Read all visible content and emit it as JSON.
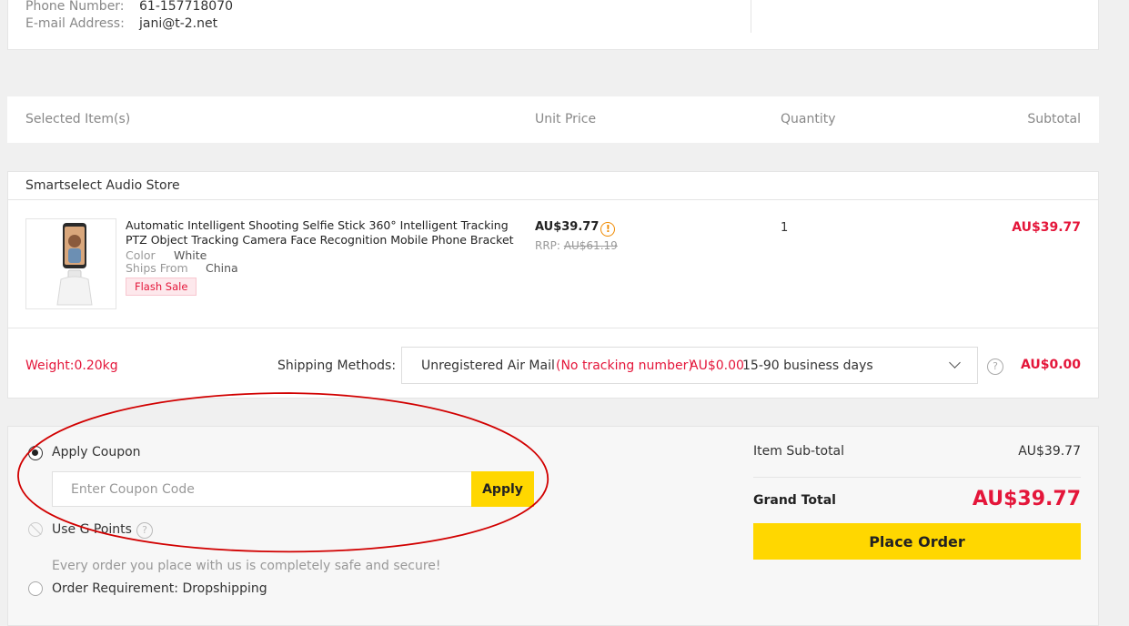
{
  "contact": {
    "phone_label": "Phone Number:",
    "phone": "61-157718070",
    "email_label": "E-mail Address:",
    "email": "jani@t-2.net"
  },
  "table_header": {
    "items": "Selected Item(s)",
    "unit_price": "Unit Price",
    "quantity": "Quantity",
    "subtotal": "Subtotal"
  },
  "store": {
    "name": "Smartselect Audio Store",
    "item": {
      "title": "Automatic Intelligent Shooting Selfie Stick 360° Intelligent Tracking PTZ Object Tracking Camera Face Recognition Mobile Phone Bracket",
      "color_label": "Color",
      "color": "White",
      "ships_from_label": "Ships From",
      "ships_from": "China",
      "badge": "Flash Sale",
      "price": "AU$39.77",
      "rrp_label": "RRP:",
      "rrp": "AU$61.19",
      "quantity": "1",
      "subtotal": "AU$39.77"
    },
    "weight": "Weight:0.20kg",
    "shipping_label": "Shipping Methods:",
    "shipping": {
      "method": "Unregistered Air Mail",
      "note": "(No tracking number)",
      "cost": "AU$0.00",
      "days": "15-90 business days"
    },
    "shipping_total": "AU$0.00"
  },
  "options": {
    "coupon_label": "Apply Coupon",
    "coupon_placeholder": "Enter Coupon Code",
    "apply_label": "Apply",
    "gpoints_label": "Use G Points",
    "safe_text": "Every order you place with us is completely safe and secure!",
    "dropship_label": "Order Requirement: Dropshipping"
  },
  "summary": {
    "subtotal_label": "Item Sub-total",
    "subtotal": "AU$39.77",
    "grand_label": "Grand Total",
    "grand": "AU$39.77",
    "place_order": "Place Order"
  },
  "colors": {
    "accent_yellow": "#ffd700",
    "price_red": "#e4163a",
    "annotation_red": "#d10000"
  }
}
